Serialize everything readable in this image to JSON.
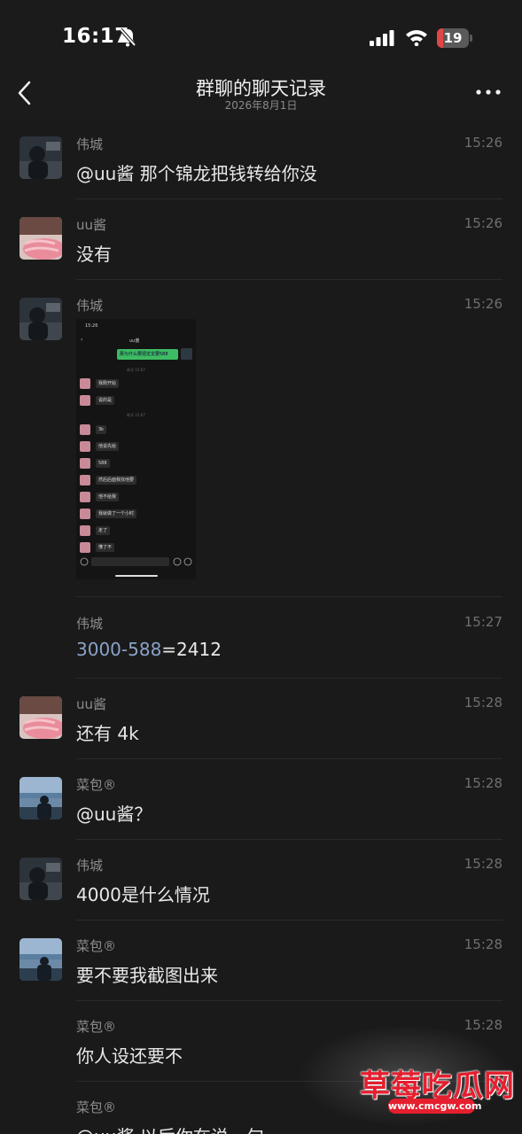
{
  "status_bar": {
    "time": "16:17",
    "battery": "19",
    "battery_level": 0.19
  },
  "header": {
    "title": "群聊的聊天记录",
    "subtitle": "2026年8月1日"
  },
  "messages": [
    {
      "sender": "伟城",
      "time": "15:26",
      "text": "@uu酱 那个锦龙把钱转给你没"
    },
    {
      "sender": "uu酱",
      "time": "15:26",
      "text": "没有"
    },
    {
      "sender": "伟城",
      "time": "15:26",
      "text": ""
    },
    {
      "sender": "伟城",
      "time": "15:27",
      "text_link": "3000-588",
      "text_rest": "=2412"
    },
    {
      "sender": "uu酱",
      "time": "15:28",
      "text": "还有 4k"
    },
    {
      "sender": "菜包®",
      "time": "15:28",
      "text": "@uu酱？"
    },
    {
      "sender": "伟城",
      "time": "15:28",
      "text": "4000是什么情况"
    },
    {
      "sender": "菜包®",
      "time": "15:28",
      "text": "要不要我截图出来"
    },
    {
      "sender": "菜包®",
      "time": "15:28",
      "text": "你人设还要不"
    },
    {
      "sender": "菜包®",
      "time": "",
      "text": "@uu酱 以后你在说一句"
    }
  ],
  "screenshot": {
    "time": "15:26",
    "title": "uu酱",
    "green_bubble": "那为什么要把龙龙要588",
    "sep1": "昨天 15:07",
    "sep2": "昨天 15:07",
    "bubbles": [
      "我刚开始",
      "说的是",
      "3k",
      "他说先给",
      "588",
      "然后后面我找他要",
      "他不给我",
      "我就做了一个小时",
      "走了",
      "懂了不"
    ]
  },
  "watermark": {
    "title": "草莓吃瓜网",
    "url": "www.cmcgw.com"
  },
  "colors": {
    "background": "#1a1a1a",
    "link": "#8aa3c8",
    "battery_red": "#e04646",
    "watermark_red": "#e51f2e"
  }
}
